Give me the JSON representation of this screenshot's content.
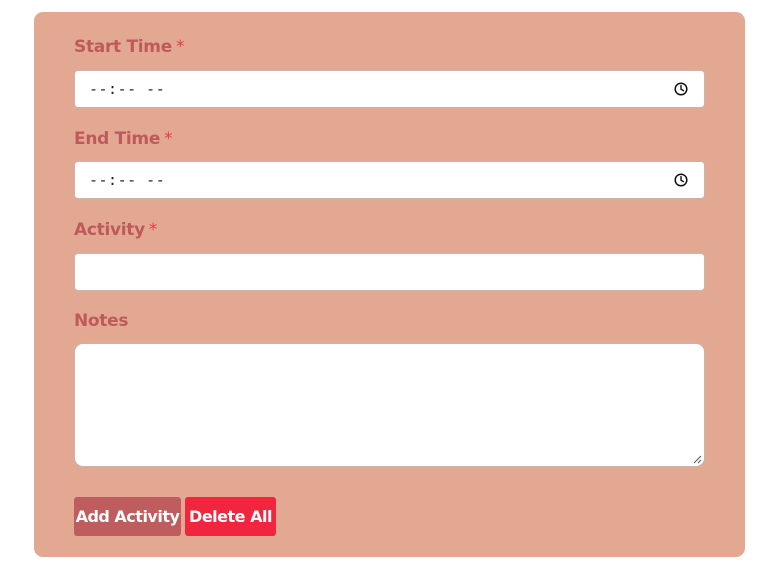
{
  "form": {
    "start_time": {
      "label": "Start Time",
      "required_mark": "*",
      "value": "--:-- --",
      "icon": "clock-icon"
    },
    "end_time": {
      "label": "End Time",
      "required_mark": "*",
      "value": "--:-- --",
      "icon": "clock-icon"
    },
    "activity": {
      "label": "Activity",
      "required_mark": "*",
      "value": ""
    },
    "notes": {
      "label": "Notes",
      "value": ""
    }
  },
  "buttons": {
    "add_label": "Add Activity",
    "delete_label": "Delete All"
  },
  "colors": {
    "card_background": "#e3a892",
    "label_text": "#bf5a5c",
    "required_mark": "#e0413f",
    "add_button": "#bf5c5e",
    "delete_button": "#f0263f"
  }
}
